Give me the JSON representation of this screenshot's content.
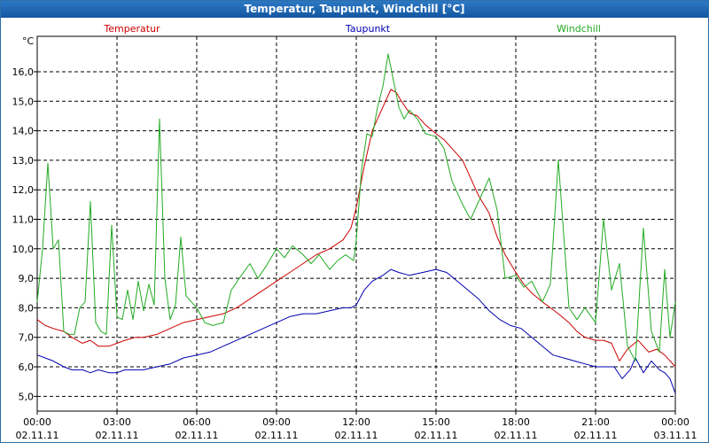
{
  "window": {
    "title": "Temperatur, Taupunkt, Windchill [°C]"
  },
  "chart_data": {
    "type": "line",
    "title": "Temperatur, Taupunkt, Windchill [°C]",
    "ylabel": "°C",
    "ylim": [
      4.5,
      17.2
    ],
    "xlim_hours": [
      0,
      24
    ],
    "grid": true,
    "legend_position": "top",
    "y_ticks": [
      "5,0",
      "6,0",
      "7,0",
      "8,0",
      "9,0",
      "10,0",
      "11,0",
      "12,0",
      "13,0",
      "14,0",
      "15,0",
      "16,0"
    ],
    "y_tick_values": [
      5,
      6,
      7,
      8,
      9,
      10,
      11,
      12,
      13,
      14,
      15,
      16
    ],
    "x_ticks": [
      {
        "time": "00:00",
        "date": "02.11.11"
      },
      {
        "time": "03:00",
        "date": "02.11.11"
      },
      {
        "time": "06:00",
        "date": "02.11.11"
      },
      {
        "time": "09:00",
        "date": "02.11.11"
      },
      {
        "time": "12:00",
        "date": "02.11.11"
      },
      {
        "time": "15:00",
        "date": "02.11.11"
      },
      {
        "time": "18:00",
        "date": "02.11.11"
      },
      {
        "time": "21:00",
        "date": "02.11.11"
      },
      {
        "time": "00:00",
        "date": "03.11.11"
      }
    ],
    "series": [
      {
        "name": "Temperatur",
        "color": "#cc0000",
        "x": [
          0,
          0.3,
          0.6,
          1.0,
          1.3,
          1.7,
          2.0,
          2.3,
          2.7,
          3.0,
          3.3,
          3.7,
          4.0,
          4.5,
          5.0,
          5.5,
          6.0,
          6.5,
          7.0,
          7.5,
          8.0,
          8.5,
          9.0,
          9.5,
          10.0,
          10.5,
          11.0,
          11.5,
          11.8,
          12.0,
          12.3,
          12.6,
          13.0,
          13.3,
          13.5,
          13.7,
          14.0,
          14.3,
          14.6,
          15.0,
          15.3,
          15.6,
          16.0,
          16.3,
          16.6,
          17.0,
          17.3,
          17.6,
          18.0,
          18.3,
          18.6,
          19.0,
          19.3,
          19.6,
          20.0,
          20.3,
          20.6,
          21.0,
          21.3,
          21.6,
          21.9,
          22.2,
          22.6,
          23.0,
          23.3,
          23.6,
          24.0
        ],
        "values": [
          7.6,
          7.4,
          7.3,
          7.2,
          7.0,
          6.8,
          6.9,
          6.7,
          6.7,
          6.8,
          6.9,
          7.0,
          7.0,
          7.1,
          7.3,
          7.5,
          7.6,
          7.7,
          7.8,
          8.0,
          8.3,
          8.6,
          8.9,
          9.2,
          9.5,
          9.8,
          10.0,
          10.3,
          10.7,
          11.4,
          12.8,
          14.0,
          14.8,
          15.4,
          15.3,
          15.0,
          14.6,
          14.5,
          14.2,
          13.9,
          13.7,
          13.4,
          13.0,
          12.4,
          11.8,
          11.2,
          10.4,
          9.8,
          9.2,
          8.8,
          8.5,
          8.2,
          8.0,
          7.8,
          7.5,
          7.2,
          7.0,
          6.9,
          6.9,
          6.8,
          6.2,
          6.6,
          6.9,
          6.5,
          6.6,
          6.4,
          6.0
        ]
      },
      {
        "name": "Taupunkt",
        "color": "#0000b0",
        "x": [
          0,
          0.3,
          0.6,
          1.0,
          1.3,
          1.7,
          2.0,
          2.3,
          2.7,
          3.0,
          3.3,
          3.7,
          4.0,
          4.5,
          5.0,
          5.5,
          6.0,
          6.5,
          7.0,
          7.5,
          8.0,
          8.5,
          9.0,
          9.5,
          10.0,
          10.5,
          11.0,
          11.5,
          11.8,
          12.0,
          12.3,
          12.6,
          13.0,
          13.3,
          13.6,
          14.0,
          14.5,
          15.0,
          15.4,
          15.8,
          16.2,
          16.6,
          17.0,
          17.4,
          17.8,
          18.2,
          18.6,
          19.0,
          19.4,
          19.8,
          20.2,
          20.6,
          21.0,
          21.4,
          21.7,
          22.0,
          22.3,
          22.5,
          22.8,
          23.1,
          23.4,
          23.6,
          23.8,
          24.0
        ],
        "values": [
          6.4,
          6.3,
          6.2,
          6.0,
          5.9,
          5.9,
          5.8,
          5.9,
          5.8,
          5.8,
          5.9,
          5.9,
          5.9,
          6.0,
          6.1,
          6.3,
          6.4,
          6.5,
          6.7,
          6.9,
          7.1,
          7.3,
          7.5,
          7.7,
          7.8,
          7.8,
          7.9,
          8.0,
          8.0,
          8.1,
          8.6,
          8.9,
          9.1,
          9.3,
          9.2,
          9.1,
          9.2,
          9.3,
          9.2,
          8.9,
          8.6,
          8.3,
          7.9,
          7.6,
          7.4,
          7.3,
          7.0,
          6.7,
          6.4,
          6.3,
          6.2,
          6.1,
          6.0,
          6.0,
          6.0,
          5.6,
          5.9,
          6.3,
          5.8,
          6.2,
          5.9,
          5.8,
          5.6,
          5.1
        ]
      },
      {
        "name": "Windchill",
        "color": "#22aa22",
        "x": [
          0,
          0.2,
          0.4,
          0.6,
          0.8,
          1.0,
          1.2,
          1.4,
          1.6,
          1.8,
          2.0,
          2.2,
          2.4,
          2.6,
          2.8,
          3.0,
          3.2,
          3.4,
          3.6,
          3.8,
          4.0,
          4.2,
          4.4,
          4.6,
          4.8,
          5.0,
          5.2,
          5.4,
          5.6,
          5.8,
          6.0,
          6.3,
          6.6,
          7.0,
          7.3,
          7.6,
          8.0,
          8.3,
          8.6,
          9.0,
          9.3,
          9.6,
          10.0,
          10.3,
          10.6,
          11.0,
          11.3,
          11.6,
          11.9,
          12.0,
          12.2,
          12.4,
          12.6,
          12.8,
          13.0,
          13.2,
          13.4,
          13.6,
          13.8,
          14.0,
          14.3,
          14.6,
          15.0,
          15.3,
          15.6,
          16.0,
          16.3,
          16.6,
          17.0,
          17.3,
          17.6,
          18.0,
          18.3,
          18.6,
          19.0,
          19.3,
          19.6,
          20.0,
          20.3,
          20.6,
          21.0,
          21.3,
          21.6,
          21.9,
          22.2,
          22.5,
          22.8,
          23.1,
          23.4,
          23.6,
          23.8,
          24.0
        ],
        "values": [
          8.2,
          10.0,
          12.9,
          10.0,
          10.3,
          7.2,
          7.1,
          7.1,
          8.0,
          8.2,
          11.6,
          7.5,
          7.2,
          7.1,
          10.8,
          7.7,
          7.6,
          8.6,
          7.6,
          8.9,
          7.9,
          8.8,
          8.1,
          14.4,
          9.0,
          7.6,
          8.1,
          10.4,
          8.4,
          8.2,
          8.0,
          7.5,
          7.4,
          7.5,
          8.6,
          9.0,
          9.5,
          9.0,
          9.4,
          10.0,
          9.7,
          10.1,
          9.8,
          9.5,
          9.8,
          9.3,
          9.6,
          9.8,
          9.6,
          10.3,
          12.7,
          13.9,
          13.8,
          14.8,
          15.5,
          16.6,
          15.7,
          14.8,
          14.4,
          14.7,
          14.4,
          13.9,
          13.8,
          13.4,
          12.3,
          11.5,
          11.0,
          11.6,
          12.4,
          11.3,
          9.0,
          9.1,
          8.7,
          8.9,
          8.2,
          8.8,
          13.0,
          8.0,
          7.6,
          8.0,
          7.5,
          11.0,
          8.6,
          9.5,
          6.7,
          6.2,
          10.7,
          7.2,
          6.5,
          9.3,
          7.0,
          8.2
        ]
      }
    ]
  }
}
